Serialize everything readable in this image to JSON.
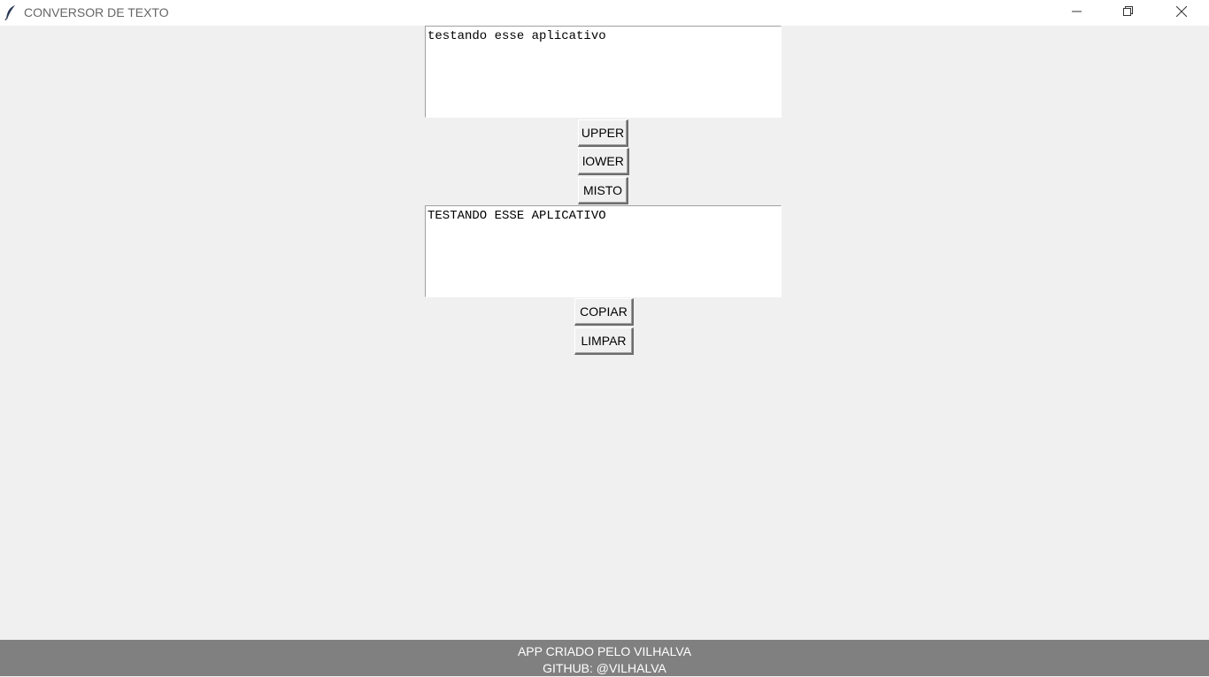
{
  "window": {
    "title": "CONVERSOR DE TEXTO",
    "icon": "feather-icon"
  },
  "input": {
    "value": "testando esse aplicativo"
  },
  "buttons": {
    "upper": "UPPER",
    "lower": "lOWER",
    "misto": "MISTO",
    "copiar": "COPIAR",
    "limpar": "LIMPAR"
  },
  "output": {
    "value": "TESTANDO ESSE APLICATIVO"
  },
  "footer": {
    "line1": "APP CRIADO PELO VILHALVA",
    "line2": "GITHUB: @VILHALVA"
  }
}
